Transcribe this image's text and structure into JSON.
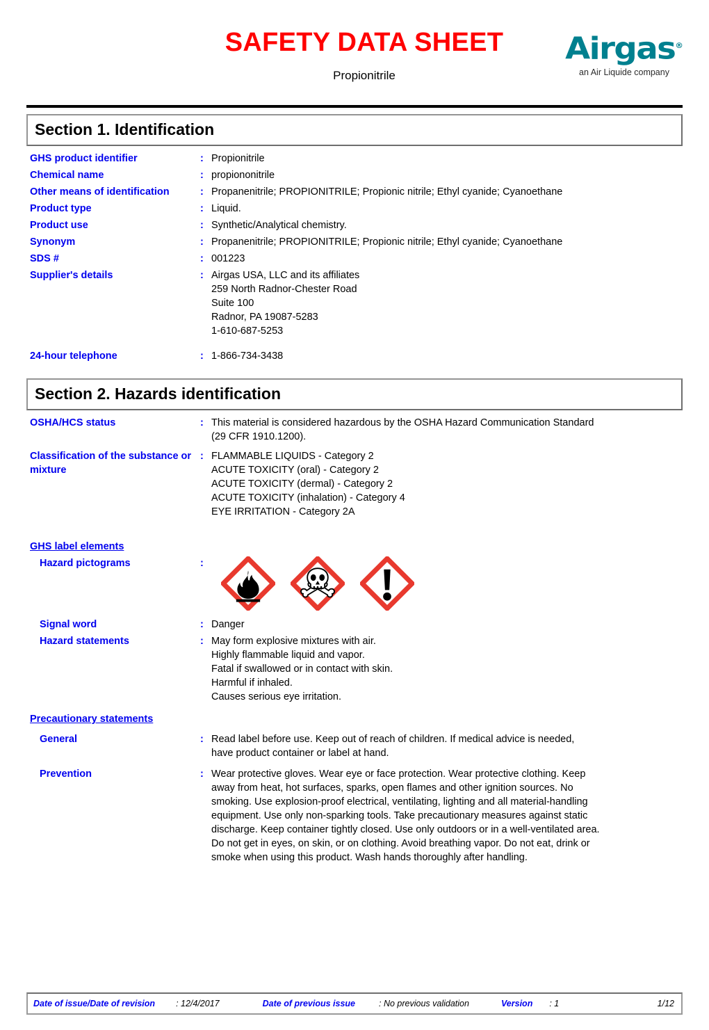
{
  "header": {
    "title": "SAFETY DATA SHEET",
    "product": "Propionitrile",
    "logo_word": "Airgas",
    "logo_reg": "®",
    "logo_tagline": "an Air Liquide company",
    "title_color": "#ff0000",
    "logo_color": "#00808f"
  },
  "section1": {
    "heading": "Section 1. Identification",
    "colon": ":",
    "rows": [
      {
        "label": "GHS product identifier",
        "value": [
          "Propionitrile"
        ]
      },
      {
        "label": "Chemical name",
        "value": [
          "propiononitrile"
        ]
      },
      {
        "label": "Other means of\nidentification",
        "label_l1": "Other means of",
        "label_l2": "identification",
        "value": [
          "Propanenitrile; PROPIONITRILE; Propionic nitrile; Ethyl cyanide; Cyanoethane"
        ]
      },
      {
        "label": "Product type",
        "value": [
          "Liquid."
        ]
      },
      {
        "label": "Product use",
        "value": [
          "Synthetic/Analytical chemistry."
        ]
      },
      {
        "label": "Synonym",
        "value": [
          "Propanenitrile; PROPIONITRILE; Propionic nitrile; Ethyl cyanide; Cyanoethane"
        ]
      },
      {
        "label": "SDS #",
        "value": [
          "001223"
        ]
      },
      {
        "label": "Supplier's details",
        "value": [
          "Airgas USA, LLC and its affiliates",
          "259 North Radnor-Chester Road",
          "Suite 100",
          "Radnor, PA 19087-5283",
          "1-610-687-5253"
        ]
      },
      {
        "label": "24-hour telephone",
        "value": [
          "1-866-734-3438"
        ]
      }
    ]
  },
  "section2": {
    "heading": "Section 2. Hazards identification",
    "colon": ":",
    "osha_label": "OSHA/HCS status",
    "osha_value": [
      "This material is considered hazardous by the OSHA Hazard Communication Standard",
      "(29 CFR 1910.1200)."
    ],
    "classification_label_l1": "Classification of the",
    "classification_label_l2": "substance or mixture",
    "classification_value": [
      "FLAMMABLE LIQUIDS - Category 2",
      "ACUTE TOXICITY (oral) - Category 2",
      "ACUTE TOXICITY (dermal) - Category 2",
      "ACUTE TOXICITY (inhalation) - Category 4",
      "EYE IRRITATION - Category 2A"
    ],
    "ghs_label_elements": "GHS label elements",
    "pictograms_label": "Hazard pictograms",
    "pictograms": [
      "flame-pictogram",
      "skull-and-crossbones-pictogram",
      "exclamation-mark-pictogram"
    ],
    "signal_word_label": "Signal word",
    "signal_word_value": "Danger",
    "hazard_statements_label": "Hazard statements",
    "hazard_statements_value": [
      "May form explosive mixtures with air.",
      "Highly flammable liquid and vapor.",
      "Fatal if swallowed or in contact with skin.",
      "Harmful if inhaled.",
      "Causes serious eye irritation."
    ],
    "precautionary_statements": "Precautionary statements",
    "general_label": "General",
    "general_value": [
      "Read label before use.  Keep out of reach of children.  If medical advice is needed,",
      "have product container or label at hand."
    ],
    "prevention_label": "Prevention",
    "prevention_value": [
      "Wear protective gloves.  Wear eye or face protection.  Wear protective clothing.  Keep",
      "away from heat, hot surfaces, sparks, open flames and other ignition sources. No",
      "smoking.  Use explosion-proof electrical, ventilating, lighting and all material-handling",
      "equipment.  Use only non-sparking tools.  Take precautionary measures against static",
      "discharge.  Keep container tightly closed.  Use only outdoors or in a well-ventilated area.",
      "Do not get in eyes, on skin, or on clothing.  Avoid breathing vapor.  Do not eat, drink or",
      "smoke when using this product.  Wash hands thoroughly after handling."
    ]
  },
  "footer": {
    "date_of_issue_label": "Date of issue/Date of revision",
    "date_of_issue_value": ": 12/4/2017",
    "previous_issue_label": "Date of previous issue",
    "previous_issue_value": ": No previous validation",
    "version_label": "Version",
    "version_value": ": 1",
    "page": "1/12"
  }
}
